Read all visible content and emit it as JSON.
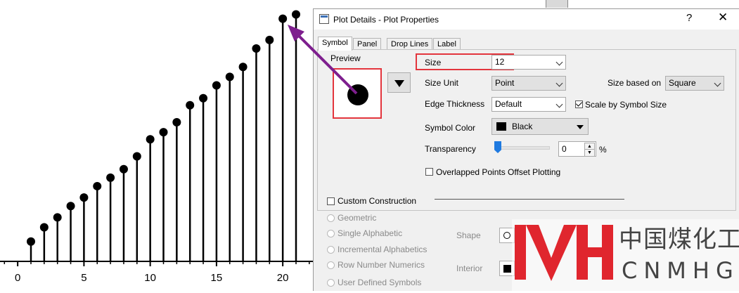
{
  "chart_data": {
    "type": "scatter",
    "x": [
      1,
      2,
      3,
      4,
      5,
      6,
      7,
      8,
      9,
      10,
      11,
      12,
      13,
      14,
      15,
      16,
      17,
      18,
      19,
      20,
      21
    ],
    "y": [
      1.4,
      2.4,
      3.1,
      3.9,
      4.5,
      5.3,
      5.9,
      6.5,
      7.4,
      8.6,
      9.1,
      9.8,
      11.0,
      11.5,
      12.4,
      13.0,
      13.7,
      15.0,
      15.6,
      17.1,
      17.4
    ],
    "xticks": [
      "0",
      "5",
      "10",
      "15",
      "20"
    ],
    "xlim": [
      -1.5,
      22.5
    ],
    "ylim": [
      0,
      18.5
    ],
    "style": "drop-lines",
    "marker_color": "#000000"
  },
  "dialog": {
    "title": "Plot Details - Plot Properties",
    "help": "?",
    "close": "✕",
    "tabs": [
      "Symbol",
      "Panel",
      "Drop Lines",
      "Label"
    ],
    "preview_label": "Preview",
    "size_label": "Size",
    "size_value": "12",
    "size_unit_label": "Size Unit",
    "size_unit_value": "Point",
    "size_based_label": "Size based on",
    "size_based_value": "Square",
    "edge_label": "Edge Thickness",
    "edge_value": "Default",
    "scale_label": "Scale by Symbol Size",
    "symbol_color_label": "Symbol Color",
    "symbol_color_value": "Black",
    "transparency_label": "Transparency",
    "transparency_value": "0",
    "transparency_unit": "%",
    "overlap_label": "Overlapped Points Offset Plotting",
    "custom_label": "Custom Construction",
    "radio_options": [
      "Geometric",
      "Single Alphabetic",
      "Incremental Alphabetics",
      "Row Number Numerics",
      "User Defined Symbols"
    ],
    "shape_label": "Shape",
    "interior_label": "Interior"
  },
  "logo": {
    "cn_text": "中国煤化工",
    "en_text": "CNMHG"
  },
  "colors": {
    "highlight": "#e3353d",
    "arrow": "#7e1f8e",
    "logo_red": "#e0262e",
    "slider": "#1f7ae0"
  }
}
